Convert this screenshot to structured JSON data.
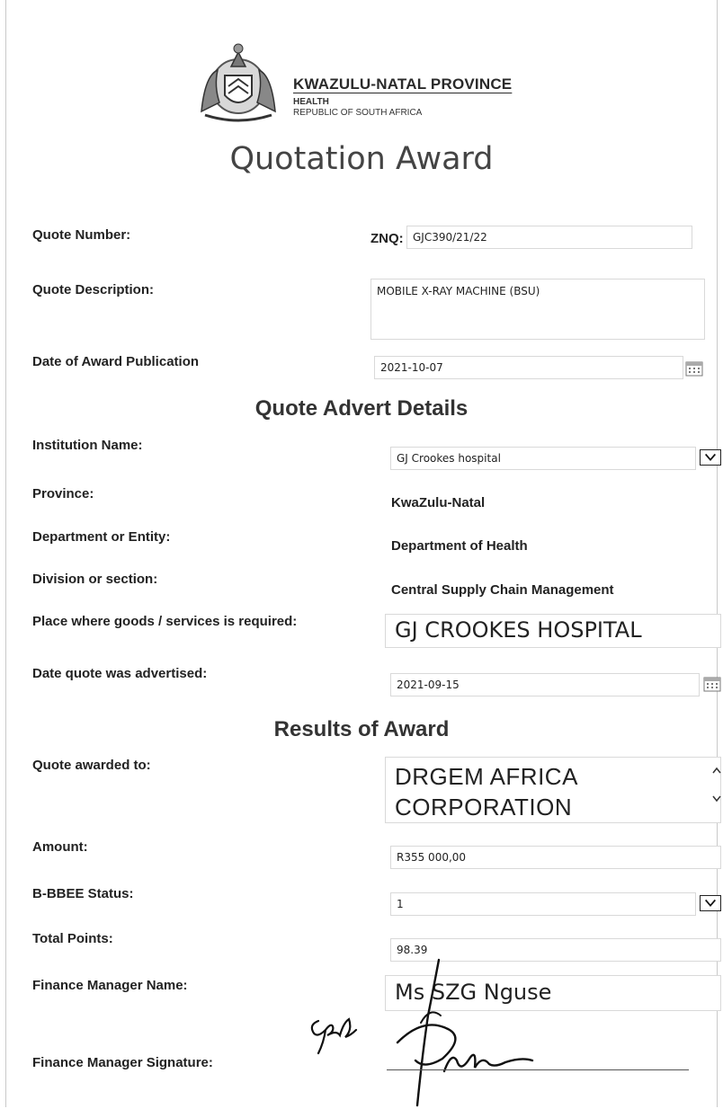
{
  "header": {
    "org_name": "KWAZULU-NATAL PROVINCE",
    "org_sub1": "HEALTH",
    "org_sub2": "REPUBLIC OF SOUTH AFRICA",
    "crest_icon": "coat-of-arms-icon"
  },
  "title": "Quotation Award",
  "award": {
    "quote_number_label": "Quote Number:",
    "quote_number_prefix": "ZNQ:",
    "quote_number_value": "GJC390/21/22",
    "quote_description_label": "Quote Description:",
    "quote_description_value": "MOBILE X-RAY MACHINE (BSU)",
    "award_date_label": "Date of Award Publication",
    "award_date_value": "2021-10-07"
  },
  "advert": {
    "section_title": "Quote Advert Details",
    "institution_label": "Institution Name:",
    "institution_value": "GJ Crookes hospital",
    "province_label": "Province:",
    "province_value": "KwaZulu-Natal",
    "department_label": "Department or Entity:",
    "department_value": "Department of Health",
    "division_label": "Division or section:",
    "division_value": "Central Supply Chain Management",
    "place_label": "Place where goods /  services is required:",
    "place_value": "GJ CROOKES HOSPITAL",
    "advertised_label": "Date quote was advertised:",
    "advertised_value": "2021-09-15"
  },
  "results": {
    "section_title": "Results of Award",
    "awarded_to_label": "Quote awarded to:",
    "awarded_to_value": "DRGEM AFRICA CORPORATION",
    "amount_label": "Amount:",
    "amount_value": "R355 000,00",
    "bbbee_label": "B-BBEE Status:",
    "bbbee_value": "1",
    "points_label": "Total Points:",
    "points_value": "98.39",
    "fm_name_label": "Finance Manager Name:",
    "fm_name_value": "Ms SZG Nguse",
    "fm_signature_label": "Finance Manager Signature:"
  },
  "icons": {
    "dropdown": "chevron-down-icon",
    "calendar": "calendar-icon",
    "scroll": "scroll-arrows-icon"
  }
}
